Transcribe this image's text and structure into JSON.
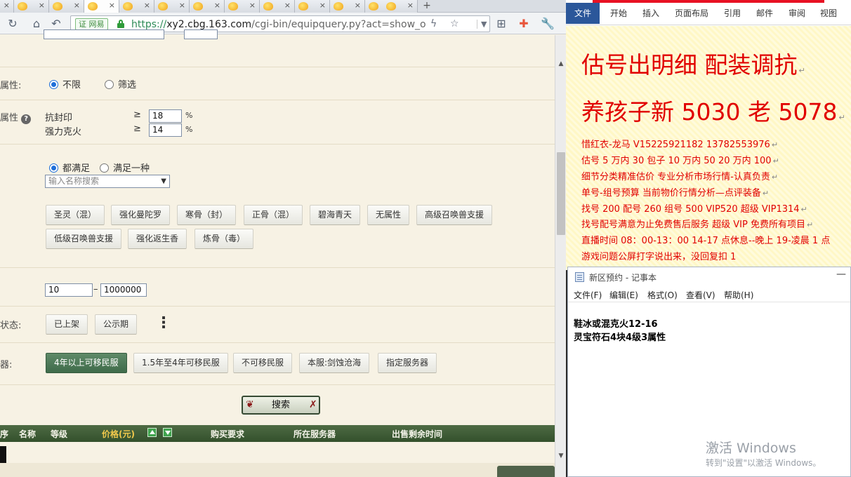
{
  "browser": {
    "new_tab_glyph": "+",
    "tab_close_glyph": "×",
    "cert_label": "网易",
    "url_protocol": "https://",
    "url_domain": "xy2.cbg.163.com",
    "url_path": "/cgi-bin/equipquery.py?act=show_ove"
  },
  "page": {
    "attr_label": "属性:",
    "attr_options": [
      "不限",
      "筛选"
    ],
    "attr2_label": "属性",
    "resist1_label": "抗封印",
    "resist1_op": "≥",
    "resist1_value": "18",
    "resist1_unit": "%",
    "resist2_label": "强力克火",
    "resist2_op": "≥",
    "resist2_value": "14",
    "resist2_unit": "%",
    "match_options": [
      "都满足",
      "满足一种"
    ],
    "name_search_placeholder": "输入名称搜索",
    "skill_buttons": [
      "圣灵（混）",
      "强化曼陀罗",
      "寒骨（封）",
      "正骨（混）",
      "碧海青天",
      "无属性",
      "高级召唤兽支援",
      "低级召唤兽支援",
      "强化返生香",
      "炼骨（毒）"
    ],
    "range_min": "10",
    "range_sep": "–",
    "range_max": "1000000",
    "status_label": "状态:",
    "status_buttons": [
      "已上架",
      "公示期"
    ],
    "more_glyph": "⋮",
    "server_label": "器:",
    "server_buttons": [
      "4年以上可移民服",
      "1.5年至4年可移民服",
      "不可移民服",
      "本服:剑蚀沧海",
      "指定服务器"
    ],
    "search_button": "搜索",
    "table_headers": {
      "seq": "序",
      "name": "名称",
      "level": "等级",
      "price": "价格(元)",
      "buy_req": "购买要求",
      "server": "所在服务器",
      "remaining": "出售剩余时间"
    }
  },
  "word": {
    "tabs": [
      "文件",
      "开始",
      "插入",
      "页面布局",
      "引用",
      "邮件",
      "审阅",
      "视图"
    ],
    "line1": "估号出明细 配装调抗",
    "line2": "养孩子新 5030 老 5078",
    "lines": [
      "惜红衣-龙马 V15225921182   13782553976",
      "估号 5 万内 30 包子  10 万内 50  20 万内 100",
      "细节分类精准估价  专业分析市场行情-认真负责",
      "单号-组号预算   当前物价行情分析—点评装备",
      "找号 200   配号 260   组号 500 VIP520   超级 VIP1314",
      "找号配号满意为止免费售后服务  超级 VIP 免费所有项目",
      "直播时间 08：00-13：00 14-17 点休息--晚上 19-凌晨 1 点",
      "游戏问题公屏打字说出来，没回复扣 1"
    ]
  },
  "notepad": {
    "title": "新区预约 - 记事本",
    "menu": [
      "文件(F)",
      "编辑(E)",
      "格式(O)",
      "查看(V)",
      "帮助(H)"
    ],
    "content_line1": "鞋冰或混克火12-16",
    "content_line2": "灵宝符石4块4级3属性"
  },
  "watermark": {
    "line1": "激活 Windows",
    "line2": "转到\"设置\"以激活 Windows。"
  },
  "colors": {
    "page_bg": "#f7f2e4",
    "selected_button": "#3f6b4a",
    "table_header": "#33502c",
    "word_red": "#e10000",
    "word_file_tab": "#2b579a"
  }
}
